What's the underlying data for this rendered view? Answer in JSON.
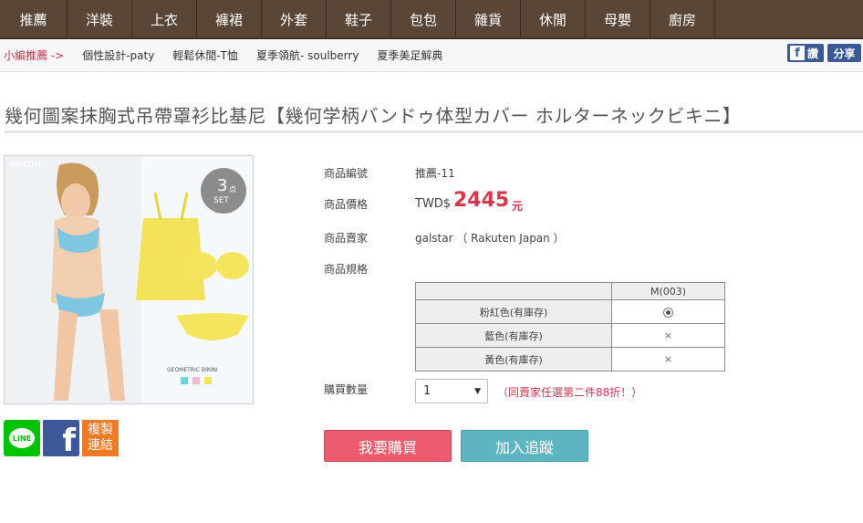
{
  "nav": {
    "items": [
      {
        "label": "推薦"
      },
      {
        "label": "洋裝"
      },
      {
        "label": "上衣"
      },
      {
        "label": "褲裙"
      },
      {
        "label": "外套"
      },
      {
        "label": "鞋子"
      },
      {
        "label": "包包"
      },
      {
        "label": "雜貨"
      },
      {
        "label": "休閒"
      },
      {
        "label": "母嬰"
      },
      {
        "label": "廚房"
      }
    ]
  },
  "subnav": {
    "lead": "小編推薦 ->",
    "links": [
      "個性設計-paty",
      "輕鬆休閒-T恤",
      "夏季領航- soulberry",
      "夏季美足解典"
    ],
    "fb_like": "讚",
    "fb_share": "分享"
  },
  "product": {
    "title": "幾何圖案抹胸式吊帶罩衫比基尼【幾何学柄バンドゥ体型カバー ホルターネックビキニ】",
    "image_text": {
      "brand": "Re:EDIT",
      "badge_num": "3",
      "badge_unit": "点",
      "badge_set": "SET",
      "caption": "GEOMETRIC BIKINI"
    },
    "code_label": "商品編號",
    "code_value": "推薦-11",
    "price_label": "商品價格",
    "price_currency": "TWD$",
    "price_value": "2445",
    "price_unit": "元",
    "seller_label": "商品賣家",
    "seller_value": "galstar （ Rakuten Japan ）",
    "spec_label": "商品規格",
    "qty_label": "購買數量",
    "qty_value": "1",
    "promo_text": "（同賣家任選第二件88折！）"
  },
  "options": {
    "column": "M(003)",
    "rows": [
      {
        "label": "粉紅色(有庫存)",
        "state": "selected"
      },
      {
        "label": "藍色(有庫存)",
        "value": "×"
      },
      {
        "label": "黃色(有庫存)",
        "value": "×"
      }
    ]
  },
  "social": {
    "line": "LINE",
    "fb": "f",
    "copy_line1": "複製",
    "copy_line2": "連結"
  },
  "actions": {
    "buy": "我要購買",
    "track": "加入追蹤"
  },
  "colors": {
    "nav_bg": "#5a4636",
    "price": "#d9364e",
    "buy_button": "#ef5b6e",
    "track_button": "#5fb4c2"
  }
}
